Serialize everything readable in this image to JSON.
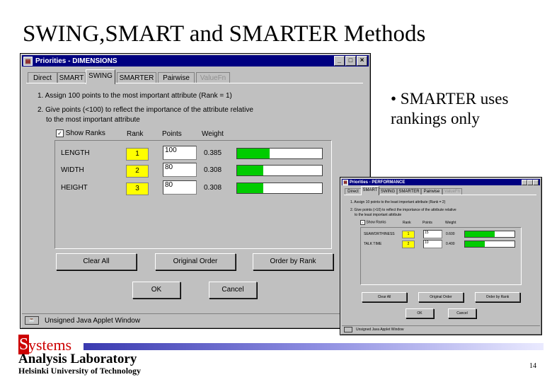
{
  "slide": {
    "title": "SWING,SMART and SMARTER Methods",
    "bullet": "• SMARTER uses rankings only",
    "page_number": "14"
  },
  "footer": {
    "logo_letter": "S",
    "logo_word": "ystems",
    "lab": "Analysis Laboratory",
    "university": "Helsinki University of Technology"
  },
  "main_window": {
    "title": "Priorities - DIMENSIONS",
    "icon": "app-icon",
    "controls": {
      "minimize": "_",
      "maximize": "□",
      "close": "×"
    },
    "tabs": [
      "Direct",
      "SMART",
      "SWING",
      "SMARTER",
      "Pairwise",
      "ValueFn"
    ],
    "active_tab": "SWING",
    "instruction1": "1. Assign 100 points to the most important attribute (Rank = 1)",
    "instruction2": "2. Give points (<100) to reflect the importance of the attribute relative",
    "instruction2b": "to the most important attribute",
    "show_ranks_label": "Show Ranks",
    "show_ranks_checked": true,
    "col_rank": "Rank",
    "col_points": "Points",
    "col_weight": "Weight",
    "rows": [
      {
        "name": "LENGTH",
        "rank": "1",
        "points": "100",
        "weight": "0.385",
        "fill": 0.385
      },
      {
        "name": "WIDTH",
        "rank": "2",
        "points": "80",
        "weight": "0.308",
        "fill": 0.308
      },
      {
        "name": "HEIGHT",
        "rank": "3",
        "points": "80",
        "weight": "0.308",
        "fill": 0.308
      }
    ],
    "btn_clear": "Clear All",
    "btn_original": "Original Order",
    "btn_order": "Order by Rank",
    "btn_ok": "OK",
    "btn_cancel": "Cancel",
    "status": "Unsigned Java Applet Window",
    "bar_color": "#00cc00",
    "rank_color": "#ffff00"
  },
  "small_window": {
    "title": "Priorities - PERFORMANCE",
    "tabs": [
      "Direct",
      "SMART",
      "SWING",
      "SMARTER",
      "Pairwise",
      "ValueFn"
    ],
    "active_tab": "SMART",
    "instruction1": "1. Assign 10 points to the least important attribute (Rank = 2)",
    "instruction2": "2. Give points (>10) to reflect the importance of the attribute relative",
    "instruction2b": "to the least important attribute",
    "show_ranks_label": "Show Ranks",
    "col_rank": "Rank",
    "col_points": "Points",
    "col_weight": "Weight",
    "rows": [
      {
        "name": "SEAWORTHINESS",
        "rank": "1",
        "points": "15",
        "weight": "0.600",
        "fill": 0.6
      },
      {
        "name": "TALK TIME",
        "rank": "2",
        "points": "10",
        "weight": "0.400",
        "fill": 0.4
      }
    ],
    "btn_clear": "Clear All",
    "btn_original": "Original Order",
    "btn_order": "Order by Rank",
    "btn_ok": "OK",
    "btn_cancel": "Cancel",
    "status": "Unsigned Java Applet Window"
  }
}
